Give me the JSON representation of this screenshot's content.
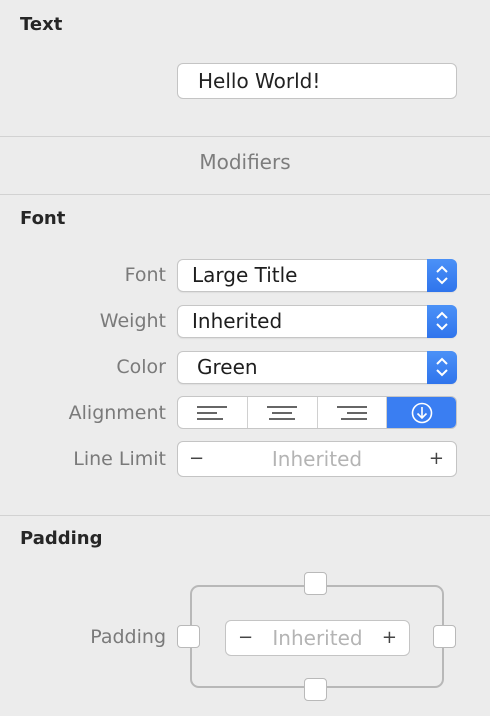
{
  "text_section": {
    "title": "Text",
    "value": "Hello World!"
  },
  "modifiers_label": "Modifiers",
  "font_section": {
    "title": "Font",
    "font": {
      "label": "Font",
      "value": "Large Title"
    },
    "weight": {
      "label": "Weight",
      "value": "Inherited"
    },
    "color": {
      "label": "Color",
      "value": "Green"
    },
    "alignment": {
      "label": "Alignment"
    },
    "line_limit": {
      "label": "Line Limit",
      "minus": "−",
      "placeholder": "Inherited",
      "plus": "+"
    }
  },
  "padding_section": {
    "title": "Padding",
    "label": "Padding",
    "minus": "−",
    "placeholder": "Inherited",
    "plus": "+"
  },
  "colors": {
    "accent": "#3a7ef2",
    "background": "#ececec"
  }
}
